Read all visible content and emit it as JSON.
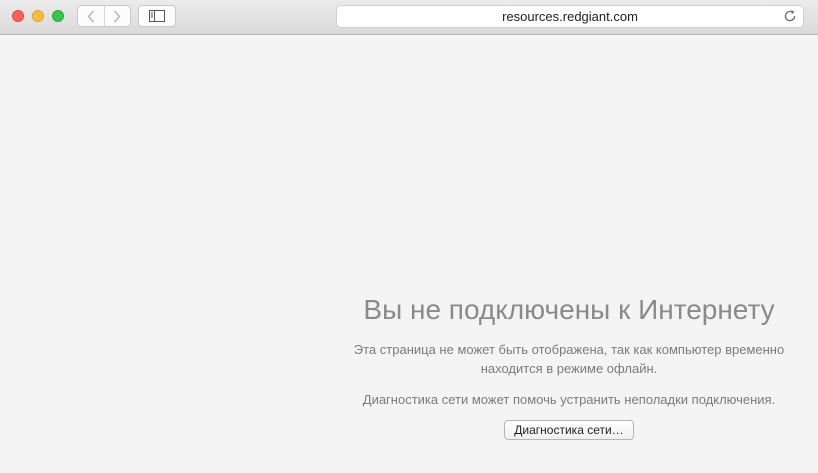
{
  "window": {
    "traffic_lights": [
      "close",
      "minimize",
      "zoom"
    ],
    "colors": {
      "close": "#fc605c",
      "minimize": "#fdbc40",
      "zoom": "#34c84a"
    }
  },
  "toolbar": {
    "back_icon": "chevron-left-icon",
    "forward_icon": "chevron-right-icon",
    "sidebar_icon": "sidebar-icon",
    "address": "resources.redgiant.com",
    "reload_icon": "reload-icon"
  },
  "offline_page": {
    "title": "Вы не подключены к Интернету",
    "description_line1": "Эта страница не может быть отображена, так как компьютер временно",
    "description_line2": "находится в режиме офлайн.",
    "diagnostics_text": "Диагностика сети может помочь устранить неполадки подключения.",
    "diagnostics_button": "Диагностика сети…"
  }
}
